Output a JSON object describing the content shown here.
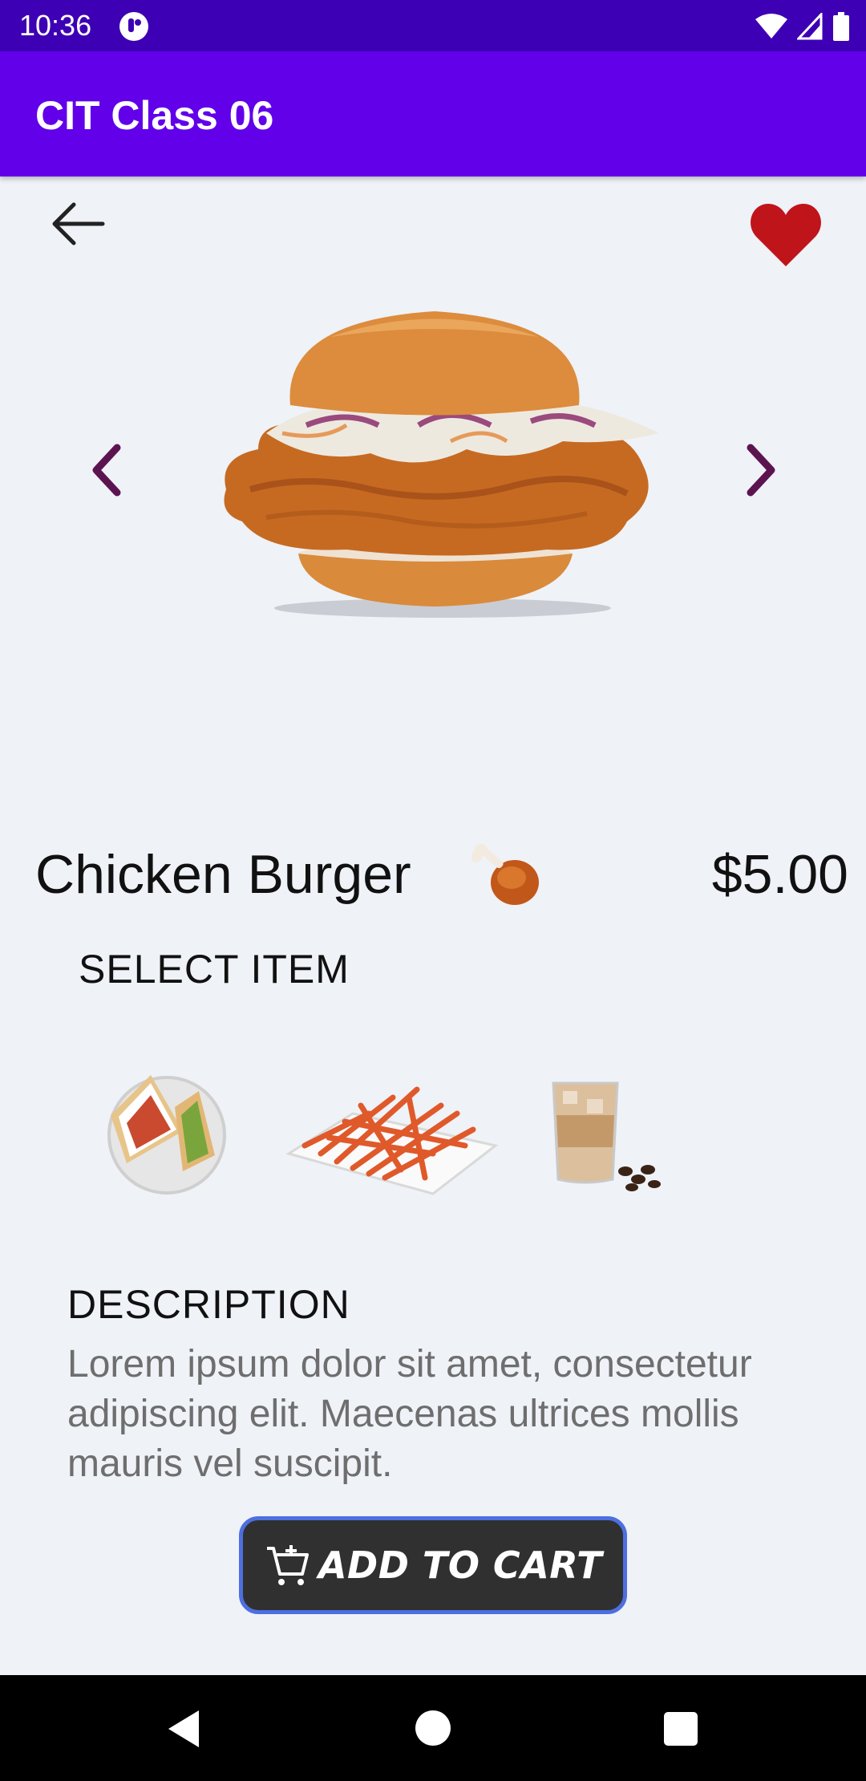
{
  "status_bar": {
    "time": "10:36",
    "app_icon": "app-notification-icon",
    "wifi": "wifi-icon",
    "signal": "signal-icon",
    "battery": "battery-icon"
  },
  "app_bar": {
    "title": "CIT Class 06"
  },
  "top_actions": {
    "back_icon": "arrow-back-icon",
    "favorite_icon": "heart-icon",
    "favorite_color": "#c0141b"
  },
  "carousel": {
    "prev_icon": "chevron-left-icon",
    "next_icon": "chevron-right-icon",
    "arrow_color": "#5c1450"
  },
  "product": {
    "name": "Chicken Burger",
    "emoji": "drumstick-icon",
    "price": "$5.00"
  },
  "select_item": {
    "heading": "SELECT ITEM",
    "items": [
      {
        "icon": "sandwich-icon"
      },
      {
        "icon": "fries-icon"
      },
      {
        "icon": "iced-coffee-icon"
      }
    ]
  },
  "description": {
    "heading": "DESCRIPTION",
    "text": "Lorem ipsum dolor sit amet, consectetur adipiscing elit. Maecenas ultrices mollis mauris vel suscipit."
  },
  "cart_button": {
    "label": "ADD TO CART",
    "icon": "cart-add-icon",
    "border_color": "#4d6fe0",
    "background": "#303030"
  },
  "system_nav": {
    "back": "nav-back-icon",
    "home": "nav-home-icon",
    "recents": "nav-recents-icon"
  }
}
